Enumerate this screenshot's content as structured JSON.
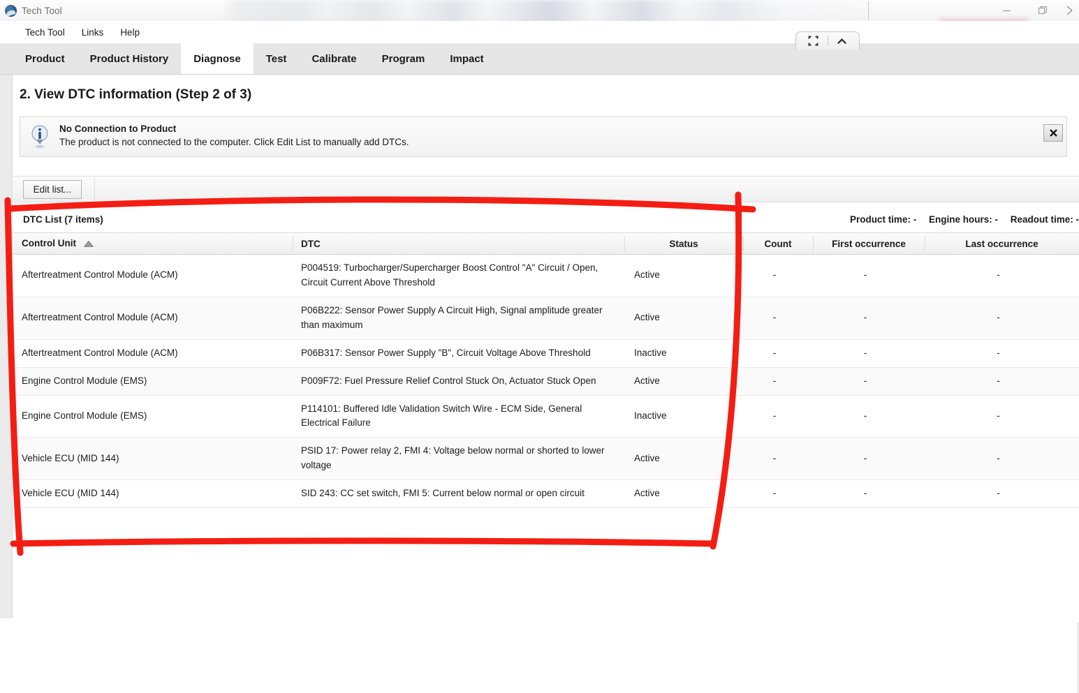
{
  "window": {
    "title": "Tech Tool",
    "app_icon": "app-logo-icon",
    "controls": {
      "minimize": "minimize-icon",
      "restore": "restore-icon",
      "close": "close-icon"
    }
  },
  "menubar": {
    "items": [
      {
        "label": "Tech Tool"
      },
      {
        "label": "Links"
      },
      {
        "label": "Help"
      }
    ]
  },
  "tabs": [
    {
      "label": "Product",
      "active": false
    },
    {
      "label": "Product History",
      "active": false
    },
    {
      "label": "Diagnose",
      "active": true
    },
    {
      "label": "Test",
      "active": false
    },
    {
      "label": "Calibrate",
      "active": false
    },
    {
      "label": "Program",
      "active": false
    },
    {
      "label": "Impact",
      "active": false
    }
  ],
  "page": {
    "title": "2. View DTC information (Step 2 of 3)"
  },
  "banner": {
    "icon": "info-icon",
    "title": "No Connection to Product",
    "text": "The product is not connected to the computer. Click Edit List to manually add DTCs.",
    "close_label": "✖"
  },
  "toolbar": {
    "edit_list_label": "Edit list..."
  },
  "list": {
    "title": "DTC List (7 items)",
    "meta": {
      "product_time": "Product time: -",
      "engine_hours": "Engine hours: -",
      "readout_time": "Readout time: -"
    },
    "columns": [
      {
        "key": "control_unit",
        "label": "Control Unit",
        "sorted": "asc"
      },
      {
        "key": "dtc",
        "label": "DTC"
      },
      {
        "key": "status",
        "label": "Status"
      },
      {
        "key": "count",
        "label": "Count"
      },
      {
        "key": "first_occurrence",
        "label": "First occurrence"
      },
      {
        "key": "last_occurrence",
        "label": "Last occurrence"
      }
    ],
    "rows": [
      {
        "control_unit": "Aftertreatment Control Module (ACM)",
        "dtc": "P004519: Turbocharger/Supercharger Boost Control \"A\" Circuit / Open, Circuit Current Above Threshold",
        "status": "Active",
        "count": "-",
        "first_occurrence": "-",
        "last_occurrence": "-"
      },
      {
        "control_unit": "Aftertreatment Control Module (ACM)",
        "dtc": "P06B222: Sensor Power Supply A Circuit High, Signal amplitude greater than maximum",
        "status": "Active",
        "count": "-",
        "first_occurrence": "-",
        "last_occurrence": "-"
      },
      {
        "control_unit": "Aftertreatment Control Module (ACM)",
        "dtc": "P06B317: Sensor Power Supply \"B\", Circuit Voltage Above Threshold",
        "status": "Inactive",
        "count": "-",
        "first_occurrence": "-",
        "last_occurrence": "-"
      },
      {
        "control_unit": "Engine Control Module (EMS)",
        "dtc": "P009F72: Fuel Pressure Relief Control Stuck On, Actuator Stuck Open",
        "status": "Active",
        "count": "-",
        "first_occurrence": "-",
        "last_occurrence": "-"
      },
      {
        "control_unit": "Engine Control Module (EMS)",
        "dtc": "P114101: Buffered Idle Validation Switch Wire - ECM Side, General Electrical Failure",
        "status": "Inactive",
        "count": "-",
        "first_occurrence": "-",
        "last_occurrence": "-"
      },
      {
        "control_unit": "Vehicle ECU (MID 144)",
        "dtc": "PSID 17: Power relay 2, FMI 4: Voltage below normal or shorted to lower voltage",
        "status": "Active",
        "count": "-",
        "first_occurrence": "-",
        "last_occurrence": "-"
      },
      {
        "control_unit": "Vehicle ECU (MID 144)",
        "dtc": "SID 243: CC set switch, FMI 5: Current below normal or open circuit",
        "status": "Active",
        "count": "-",
        "first_occurrence": "-",
        "last_occurrence": "-"
      }
    ]
  },
  "view_controls": {
    "fullscreen": "fullscreen-icon",
    "collapse": "chevron-up-icon"
  },
  "annotation": {
    "color": "#f41d14",
    "shape": "hand-drawn-rectangle"
  }
}
